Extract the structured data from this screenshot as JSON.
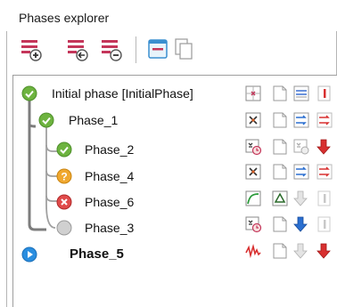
{
  "panel": {
    "title": "Phases explorer"
  },
  "toolbar": {
    "buttons": [
      {
        "name": "add-phase-button",
        "icon": "add-phase-icon"
      },
      {
        "name": "back-phase-button",
        "icon": "previous-phase-icon"
      },
      {
        "name": "remove-phase-button",
        "icon": "remove-phase-icon"
      },
      {
        "name": "properties-button",
        "icon": "properties-window-icon"
      },
      {
        "name": "copy-button",
        "icon": "copy-pages-icon"
      }
    ]
  },
  "tree": {
    "nodes": [
      {
        "label": "Initial phase [InitialPhase]",
        "status": "ok",
        "status_color": "#6db33f",
        "depth": 0,
        "cells": [
          "crosshair-grid-icon",
          "page-icon",
          "lines-icon",
          "red-bar-icon"
        ]
      },
      {
        "label": "Phase_1",
        "status": "ok",
        "status_color": "#6db33f",
        "depth": 1,
        "cells": [
          "arrows-grid-icon",
          "page-icon",
          "blue-arrows-icon",
          "red-arrows-icon"
        ]
      },
      {
        "label": "Phase_2",
        "status": "ok",
        "status_color": "#6db33f",
        "depth": 2,
        "cells": [
          "calc-clock-icon",
          "page-icon",
          "gray-calc-icon",
          "red-down-arrow-icon"
        ]
      },
      {
        "label": "Phase_4",
        "status": "warning",
        "status_color": "#f0a830",
        "depth": 2,
        "cells": [
          "arrows-grid-icon",
          "page-icon",
          "blue-arrows-icon",
          "red-arrows-icon"
        ]
      },
      {
        "label": "Phase_6",
        "status": "error",
        "status_color": "#e04a4a",
        "depth": 2,
        "cells": [
          "green-curve-icon",
          "triangle-icon",
          "gray-down-arrow-icon",
          "gray-bar-icon"
        ]
      },
      {
        "label": "Phase_3",
        "status": "pending",
        "status_color": "#c8c8c8",
        "depth": 2,
        "cells": [
          "calc-clock-icon",
          "page-icon",
          "blue-down-arrow-icon",
          "gray-bar-icon"
        ]
      },
      {
        "label": "Phase_5",
        "status": "selected",
        "status_color": "#2a8ee0",
        "depth": 0,
        "cells": [
          "red-wave-icon",
          "page-icon",
          "gray-down-arrow-icon",
          "red-down-arrow-icon"
        ]
      }
    ]
  }
}
